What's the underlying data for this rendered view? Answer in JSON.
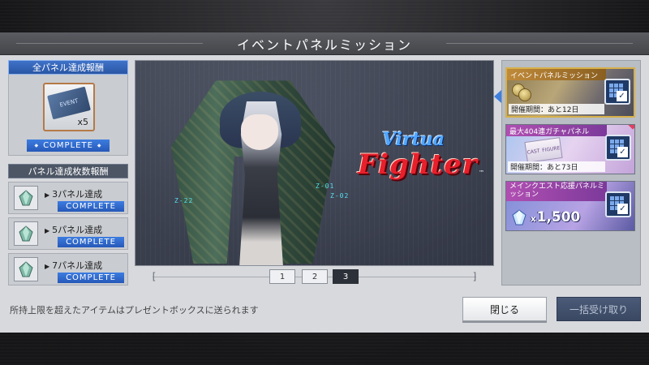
{
  "header": {
    "title": "イベントパネルミッション"
  },
  "all_panel_reward": {
    "title": "全パネル達成報酬",
    "item_label": "EVENT",
    "quantity": "x5",
    "status": "COMPLETE"
  },
  "panel_count_reward": {
    "title": "パネル達成枚数報酬",
    "rows": [
      {
        "label": "3パネル達成",
        "status": "COMPLETE"
      },
      {
        "label": "5パネル達成",
        "status": "COMPLETE"
      },
      {
        "label": "7パネル達成",
        "status": "COMPLETE"
      }
    ]
  },
  "banner": {
    "logo_top": "Virtua",
    "logo_bottom": "Fighter",
    "logo_tm": "™",
    "glow_labels": [
      "Z-22",
      "Z-01",
      "Z-02"
    ]
  },
  "pager": {
    "pages": [
      "1",
      "2",
      "3"
    ],
    "active_page": "3",
    "bracket_left": "[",
    "bracket_right": "]"
  },
  "missions": [
    {
      "title": "イベントパネルミッション",
      "period": "開催期間：あと12日",
      "selected": true
    },
    {
      "title": "最大404連ガチャパネル",
      "period": "開催期間：あと73日",
      "ticket_text_a": "CAST",
      "ticket_text_b": "FIGURE"
    },
    {
      "title": "メインクエスト応援パネルミッション",
      "amount": "1,500",
      "amount_prefix": "x"
    }
  ],
  "footer": {
    "note": "所持上限を超えたアイテムはプレゼントボックスに送られます",
    "close_label": "閉じる",
    "claim_all_label": "一括受け取り"
  },
  "colors": {
    "accent_blue": "#3d7ce0",
    "title_bar": "#4f5156",
    "selected_border": "#d6b04a",
    "disabled_button": "#3a4862"
  }
}
